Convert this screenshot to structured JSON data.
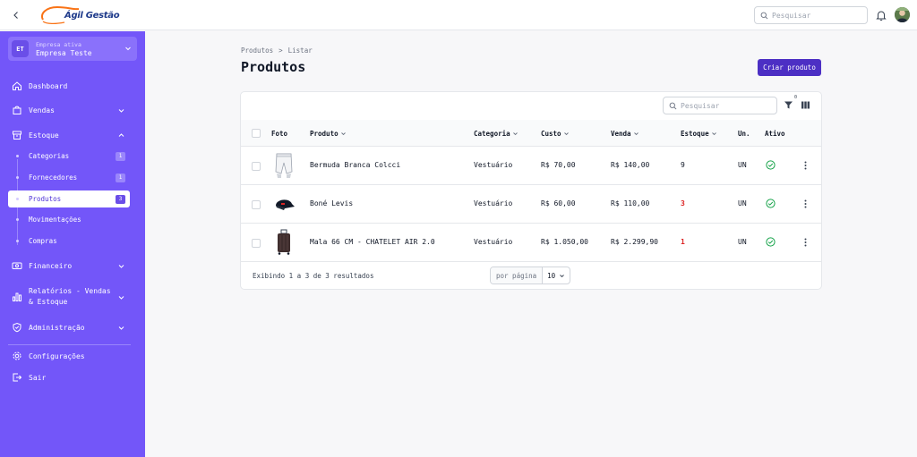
{
  "header": {
    "logo_text": "Ágil Gestão",
    "search_placeholder": "Pesquisar",
    "brand_color": "#7356f9"
  },
  "sidebar": {
    "company_label": "Empresa ativa",
    "company_name": "Empresa Teste",
    "company_initials": "ET",
    "items": [
      {
        "label": "Dashboard",
        "icon": "home-icon"
      },
      {
        "label": "Vendas",
        "icon": "shopping-bag-icon"
      },
      {
        "label": "Estoque",
        "icon": "archive-icon"
      },
      {
        "label": "Financeiro",
        "icon": "money-icon"
      },
      {
        "label": "Relatórios - Vendas & Estoque",
        "icon": "bar-chart-icon"
      },
      {
        "label": "Administração",
        "icon": "shield-check-icon"
      },
      {
        "label": "Configurações",
        "icon": "gear-icon"
      },
      {
        "label": "Sair",
        "icon": "logout-icon"
      }
    ],
    "estoque_sub": [
      {
        "label": "Categorias",
        "count": "1"
      },
      {
        "label": "Fornecedores",
        "count": "1"
      },
      {
        "label": "Produtos",
        "count": "3"
      },
      {
        "label": "Movimentações",
        "count": ""
      },
      {
        "label": "Compras",
        "count": ""
      }
    ]
  },
  "main": {
    "breadcrumb": [
      "Produtos",
      ">",
      "Listar"
    ],
    "title": "Produtos",
    "create_button": "Criar produto",
    "search_placeholder": "Pesquisar",
    "filter_count": "0",
    "columns": [
      "Foto",
      "Produto",
      "Categoria",
      "Custo",
      "Venda",
      "Estoque",
      "Un.",
      "Ativo"
    ],
    "rows": [
      {
        "produto": "Bermuda Branca Colcci",
        "categoria": "Vestuário",
        "custo": "R$ 70,00",
        "venda": "R$ 140,00",
        "estoque": "9",
        "un": "UN",
        "ativo": true
      },
      {
        "produto": "Boné Levis",
        "categoria": "Vestuário",
        "custo": "R$ 60,00",
        "venda": "R$ 110,00",
        "estoque": "3",
        "un": "UN",
        "ativo": true
      },
      {
        "produto": "Mala 66 CM - CHATELET AIR 2.0",
        "categoria": "Vestuário",
        "custo": "R$ 1.050,00",
        "venda": "R$ 2.299,90",
        "estoque": "1",
        "un": "UN",
        "ativo": true
      }
    ],
    "footer_text": "Exibindo 1 a 3 de 3 resultados",
    "per_page_label": "por página",
    "per_page_value": "10"
  }
}
